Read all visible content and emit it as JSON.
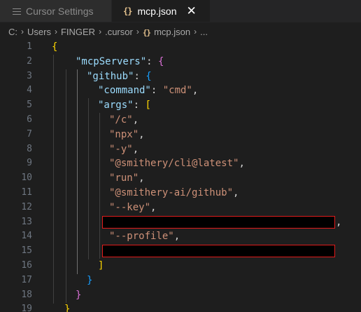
{
  "tabs": [
    {
      "label": "Cursor Settings",
      "icon": "settings-icon",
      "active": false
    },
    {
      "label": "mcp.json",
      "icon": "json-icon",
      "icon_glyph": "{}",
      "active": true,
      "close": "✕"
    }
  ],
  "breadcrumb": {
    "items": [
      "C:",
      "Users",
      "FINGER",
      ".cursor",
      "mcp.json",
      "..."
    ],
    "separator": "›",
    "json_glyph": "{}"
  },
  "editor": {
    "line_numbers": [
      "1",
      "2",
      "3",
      "4",
      "5",
      "6",
      "7",
      "8",
      "9",
      "10",
      "11",
      "12",
      "13",
      "14",
      "15",
      "16",
      "17",
      "18",
      "19"
    ],
    "keys": {
      "mcpServers": "\"mcpServers\"",
      "github": "\"github\"",
      "command": "\"command\"",
      "args": "\"args\""
    },
    "values": {
      "command": "\"cmd\""
    },
    "args": [
      "\"/c\"",
      "\"npx\"",
      "\"-y\"",
      "\"@smithery/cli@latest\"",
      "\"run\"",
      "\"@smithery-ai/github\"",
      "\"--key\"",
      "\"--profile\""
    ],
    "redacted_lines": [
      13,
      15
    ]
  },
  "colors": {
    "background": "#1e1e1e",
    "key": "#9cdcfe",
    "string": "#ce9178",
    "bracket_level_1": "#ffd700",
    "bracket_level_2": "#da70d6",
    "bracket_level_3": "#179fff",
    "redaction_border": "#e01b1b"
  }
}
